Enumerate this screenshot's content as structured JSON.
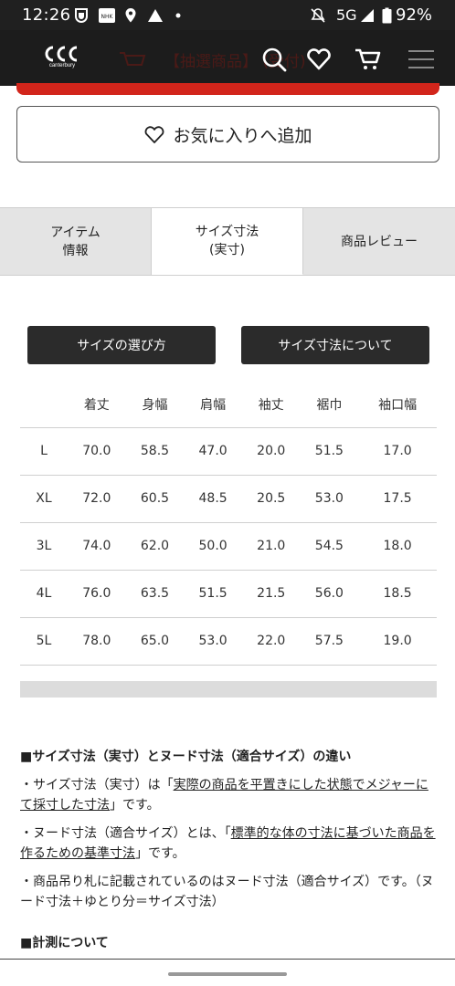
{
  "status_bar": {
    "time": "12:26",
    "app_icon_text": "NHK",
    "network": "5G",
    "battery": "92%"
  },
  "header": {
    "brand": "canterbury",
    "behind_text": "【抽選商品】 (受付)"
  },
  "favorite": {
    "label": "お気に入りへ追加"
  },
  "tabs": [
    {
      "label": "アイテム\n情報"
    },
    {
      "label": "サイズ寸法\n(実寸)"
    },
    {
      "label": "商品レビュー"
    }
  ],
  "buttons": {
    "size_guide": "サイズの選び方",
    "about_dimensions": "サイズ寸法について"
  },
  "size_table": {
    "headers": [
      "",
      "着丈",
      "身幅",
      "肩幅",
      "袖丈",
      "裾巾",
      "袖口幅"
    ],
    "rows": [
      [
        "L",
        "70.0",
        "58.5",
        "47.0",
        "20.0",
        "51.5",
        "17.0"
      ],
      [
        "XL",
        "72.0",
        "60.5",
        "48.5",
        "20.5",
        "53.0",
        "17.5"
      ],
      [
        "3L",
        "74.0",
        "62.0",
        "50.0",
        "21.0",
        "54.5",
        "18.0"
      ],
      [
        "4L",
        "76.0",
        "63.5",
        "51.5",
        "21.5",
        "56.0",
        "18.5"
      ],
      [
        "5L",
        "78.0",
        "65.0",
        "53.0",
        "22.0",
        "57.5",
        "19.0"
      ]
    ]
  },
  "notes": {
    "heading": "■サイズ寸法（実寸）とヌード寸法（適合サイズ）の違い",
    "p1_pre": "・サイズ寸法（実寸）は「",
    "p1_u": "実際の商品を平置きにした状態でメジャーにて採寸した寸法",
    "p1_post": "」です。",
    "p2_pre": "・ヌード寸法（適合サイズ）とは、「",
    "p2_u": "標準的な体の寸法に基づいた商品を作るための基準寸法",
    "p2_post": "」です。",
    "p3": "・商品吊り札に記載されているのはヌード寸法（適合サイズ）です。（ヌード寸法＋ゆとり分＝サイズ寸法）",
    "heading2": "■計測について"
  }
}
